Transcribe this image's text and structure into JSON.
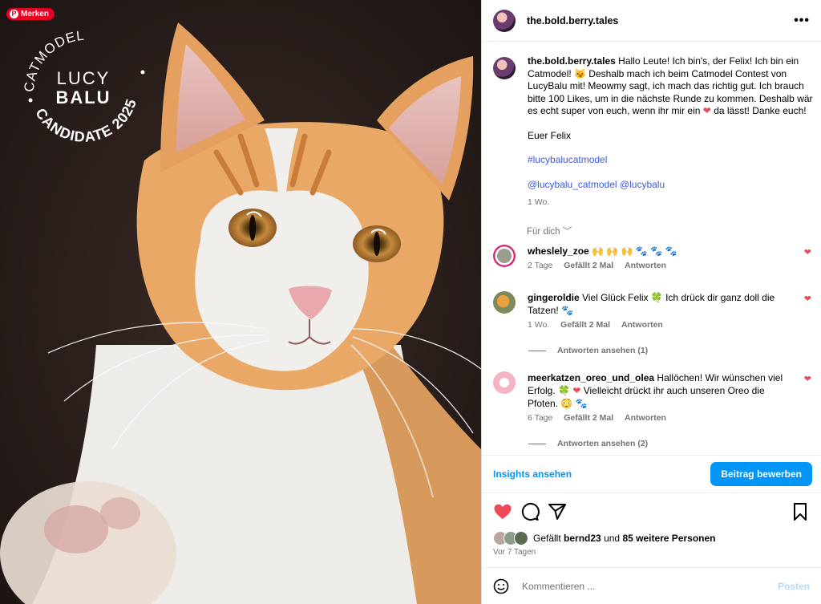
{
  "pin_label": "Merken",
  "badge": {
    "top": "CATMODEL",
    "line1": "LUCY",
    "line2": "BALU",
    "bottom": "CANDIDATE 2025"
  },
  "post": {
    "username": "the.bold.berry.tales",
    "more_icon": "more-icon"
  },
  "caption": {
    "username": "the.bold.berry.tales",
    "text_1": "Hallo Leute! Ich bin's, der Felix! Ich bin ein Catmodel! 😼 Deshalb mach ich beim Catmodel Contest von LucyBalu mit! Meowmy sagt, ich mach das richtig gut. Ich brauch bitte 100 Likes, um in die nächste Runde zu kommen. Deshalb wär es echt super von euch, wenn ihr mir ein",
    "text_2": "da lässt! Danke euch!",
    "signoff": "Euer Felix",
    "hashtag": "#lucybalucatmodel",
    "mention_1": "@lucybalu_catmodel",
    "mention_2": "@lucybalu",
    "time": "1 Wo."
  },
  "filter_label": "Für dich",
  "comments": [
    {
      "user": "wheslely_zoe",
      "text": "🙌 🙌 🙌 🐾 🐾 🐾",
      "time": "2 Tage",
      "likes": "Gefällt 2 Mal",
      "reply": "Antworten"
    },
    {
      "user": "gingeroldie",
      "text": "Viel Glück Felix 🍀 Ich drück dir ganz doll die Tatzen! 🐾",
      "time": "1 Wo.",
      "likes": "Gefällt 2 Mal",
      "reply": "Antworten",
      "view_replies": "Antworten ansehen (1)"
    },
    {
      "user": "meerkatzen_oreo_und_olea",
      "text_1": "Hallöchen! Wir wünschen viel Erfolg. 🍀",
      "text_2": "Vielleicht drückt ihr auch unseren Oreo die Pfoten. 😳 🐾",
      "time": "6 Tage",
      "likes": "Gefällt 2 Mal",
      "reply": "Antworten",
      "view_replies": "Antworten ansehen (2)"
    }
  ],
  "insights_label": "Insights ansehen",
  "promote_label": "Beitrag bewerben",
  "likes": {
    "prefix": "Gefällt",
    "user": "bernd23",
    "middle": "und",
    "others": "85 weitere Personen"
  },
  "posted_ago": "Vor 7 Tagen",
  "comment_box": {
    "placeholder": "Kommentieren ...",
    "post_label": "Posten"
  },
  "colors": {
    "accent": "#0095f6",
    "like": "#ed4956",
    "pin": "#e60023",
    "hashtag": "#3c5ad9"
  }
}
